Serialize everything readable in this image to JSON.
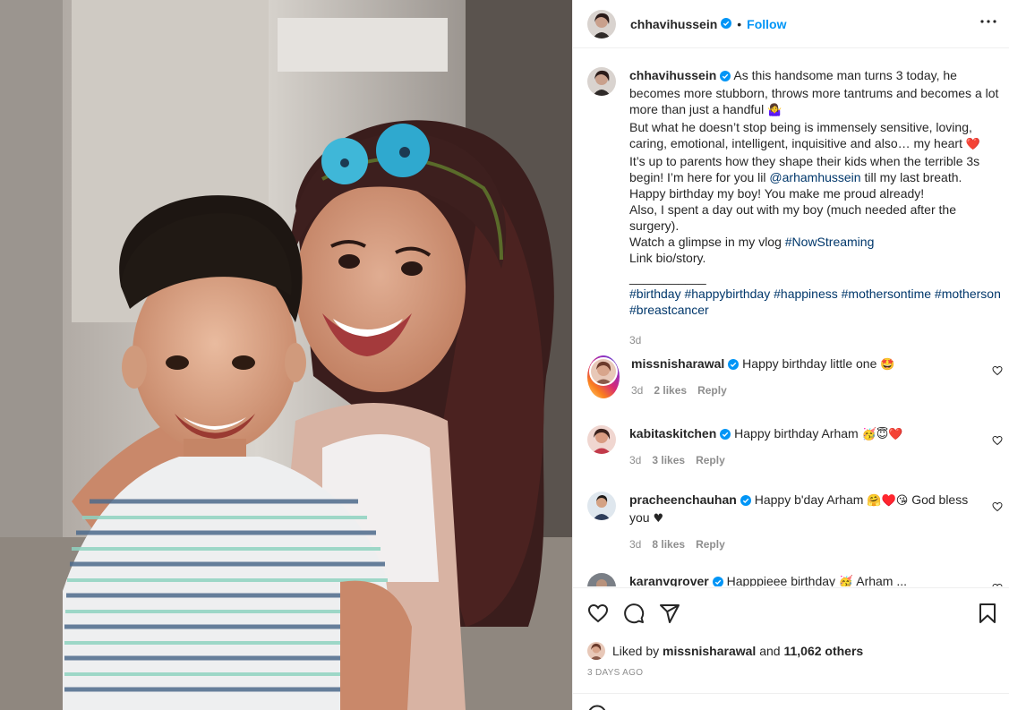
{
  "post": {
    "username": "chhavihussein",
    "follow_label": "Follow",
    "more_icon": "more-options-icon",
    "caption": {
      "line1": "As this handsome man turns 3 today, he becomes more stubborn, throws more tantrums and becomes a lot more than just a handful",
      "line1_emoji": "🤷‍♀️",
      "line2": "But what he doesn’t stop being is immensely sensitive, loving, caring, emotional, intelligent, inquisitive and also… my heart",
      "line2_emoji": "❤️",
      "line3_pre": "It’s up to parents how they shape their kids when the terrible 3s begin! I’m here for you lil",
      "line3_mention": "@arhamhussein",
      "line3_post": "till my last breath.",
      "line4": "Happy birthday my boy! You make me proud already!",
      "line5": "Also, I spent a day out with my boy (much needed after the surgery).",
      "line6_pre": "Watch a glimpse in my vlog",
      "line6_tag": "#NowStreaming",
      "line7": "Link bio/story.",
      "line8": "___________",
      "hashtags": [
        "#birthday",
        "#happybirthday",
        "#happiness",
        "#mothersontime",
        "#motherson",
        "#breastcancer"
      ],
      "time": "3d"
    },
    "comments": [
      {
        "username": "missnisharawal",
        "text": "Happy birthday little one",
        "emoji": "🤩",
        "time": "3d",
        "likes": "2 likes",
        "reply": "Reply"
      },
      {
        "username": "kabitaskitchen",
        "text": "Happy birthday Arham",
        "emoji": "🥳😇❤️",
        "time": "3d",
        "likes": "3 likes",
        "reply": "Reply"
      },
      {
        "username": "pracheenchauhan",
        "text": "Happy b'day Arham",
        "emoji": "🤗♥️😘",
        "text2": "God bless you",
        "emoji2": "♥",
        "time": "3d",
        "likes": "8 likes",
        "reply": "Reply"
      },
      {
        "username": "karanvgrover",
        "text": "Happpieee birthday",
        "emoji": "🥳",
        "text2": "Arham ..."
      }
    ],
    "liked_by_prefix": "Liked by",
    "liked_by_user": "missnisharawal",
    "liked_by_and": "and",
    "liked_by_count": "11,062 others",
    "date": "3 DAYS AGO"
  }
}
